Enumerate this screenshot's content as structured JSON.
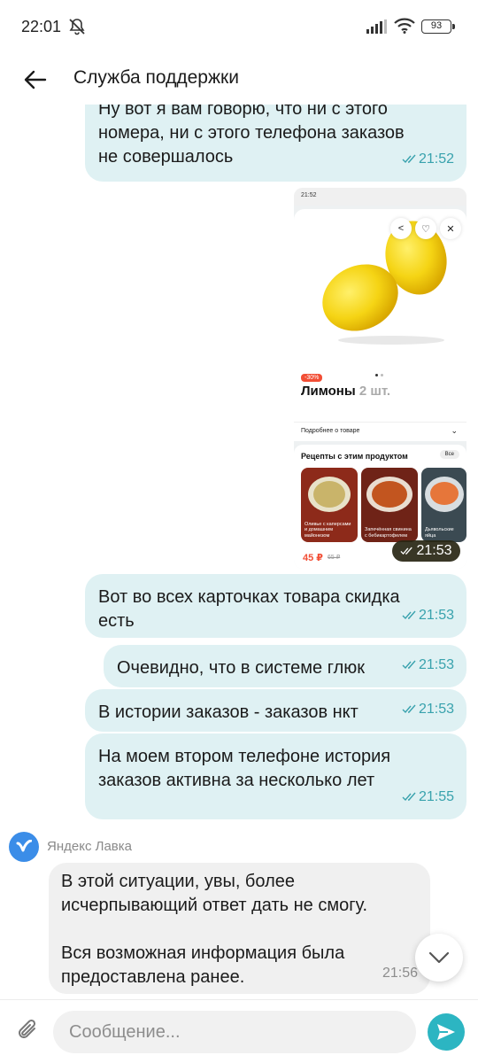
{
  "status_bar": {
    "time": "22:01",
    "battery": "93"
  },
  "header": {
    "title": "Служба поддержки"
  },
  "messages": [
    {
      "text": "Ну вот я вам говорю, что ни с этого\nномера, ни с этого телефона заказов\nне совершалось",
      "time": "21:52"
    },
    {
      "text": "Вот во всех карточках товара скидка\nесть",
      "time": "21:53"
    },
    {
      "text": "Очевидно, что в системе глюк",
      "time": "21:53"
    },
    {
      "text": "В истории заказов - заказов нкт",
      "time": "21:53"
    },
    {
      "text": "На моем втором телефоне история\nзаказов активна за несколько лет",
      "time": "21:55"
    }
  ],
  "image_message": {
    "time": "21:53",
    "screenshot": {
      "status_time": "21:52",
      "discount": "-30%",
      "product_name": "Лимоны",
      "product_count": "2 шт.",
      "details_label": "Подробнее о товаре",
      "recipes_title": "Рецепты с этим продуктом",
      "all_label": "Все",
      "recipes": [
        "Оливье с каперсами и домашним майонезом",
        "Запечённая свинина с бебикартофелем",
        "Дьявольские яйца"
      ],
      "price": "45 ₽",
      "old_price": "65 ₽"
    }
  },
  "incoming": {
    "sender": "Яндекс Лавка",
    "text": "В этой ситуации, увы, более\nисчерпывающий ответ дать не смогу.\n\nВся возможная информация была\nпредоставлена ранее.",
    "time": "21:56"
  },
  "composer": {
    "placeholder": "Сообщение..."
  },
  "colors": {
    "outgoing_bubble": "#dff1f3",
    "incoming_bubble": "#f0f0f0",
    "accent": "#2cb5c2",
    "time_tick": "#38a2ad"
  }
}
